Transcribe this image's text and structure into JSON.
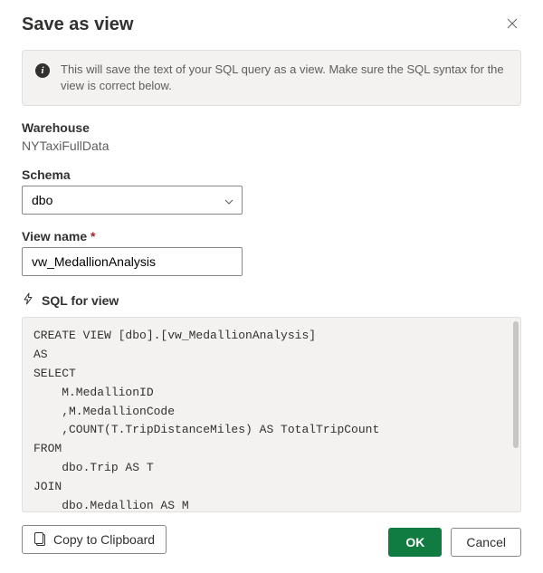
{
  "dialog": {
    "title": "Save as view",
    "close_aria": "Close"
  },
  "info": {
    "message": "This will save the text of your SQL query as a view. Make sure the SQL syntax for the view is correct below."
  },
  "warehouse": {
    "label": "Warehouse",
    "value": "NYTaxiFullData"
  },
  "schema": {
    "label": "Schema",
    "value": "dbo"
  },
  "viewName": {
    "label": "View name",
    "required_mark": "*",
    "value": "vw_MedallionAnalysis"
  },
  "sql": {
    "header": "SQL for view",
    "code": "CREATE VIEW [dbo].[vw_MedallionAnalysis]\nAS\nSELECT\n    M.MedallionID\n    ,M.MedallionCode\n    ,COUNT(T.TripDistanceMiles) AS TotalTripCount\nFROM\n    dbo.Trip AS T\nJOIN\n    dbo.Medallion AS M"
  },
  "buttons": {
    "copy": "Copy to Clipboard",
    "ok": "OK",
    "cancel": "Cancel"
  }
}
